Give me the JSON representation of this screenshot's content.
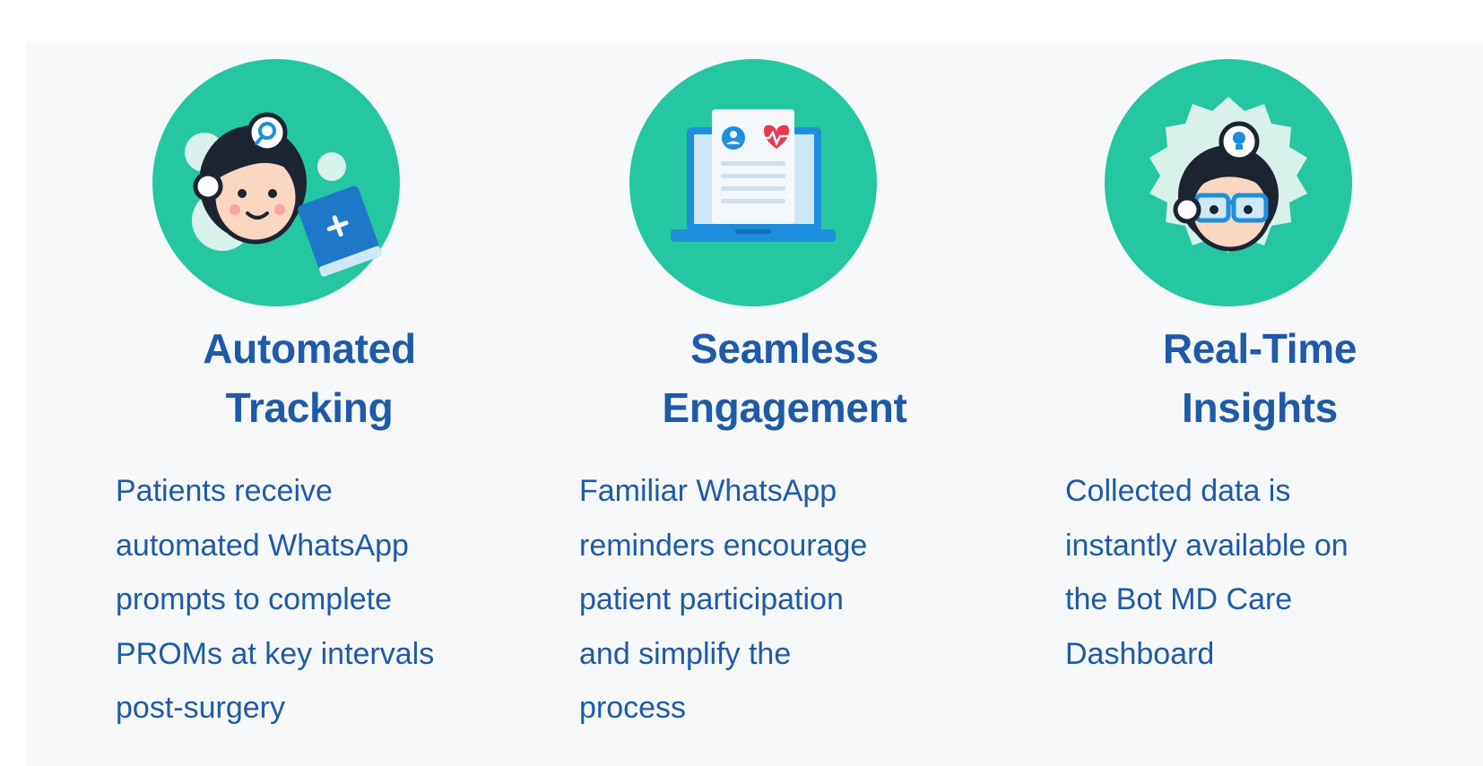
{
  "features": [
    {
      "title": "Automated\nTracking",
      "description": "Patients receive\nautomated WhatsApp\nprompts to complete\nPROMs at key intervals\npost-surgery",
      "icon": "doctor-book-icon"
    },
    {
      "title": "Seamless\nEngagement",
      "description": "Familiar WhatsApp\nreminders encourage\npatient participation\nand simplify the\nprocess",
      "icon": "laptop-health-report-icon"
    },
    {
      "title": "Real-Time\nInsights",
      "description": "Collected data is\ninstantly available on\nthe Bot MD Care\nDashboard",
      "icon": "doctor-insight-icon"
    }
  ],
  "colors": {
    "teal": "#25c7a3",
    "title": "#1f5aa8",
    "panel": "#f7f8f9"
  }
}
